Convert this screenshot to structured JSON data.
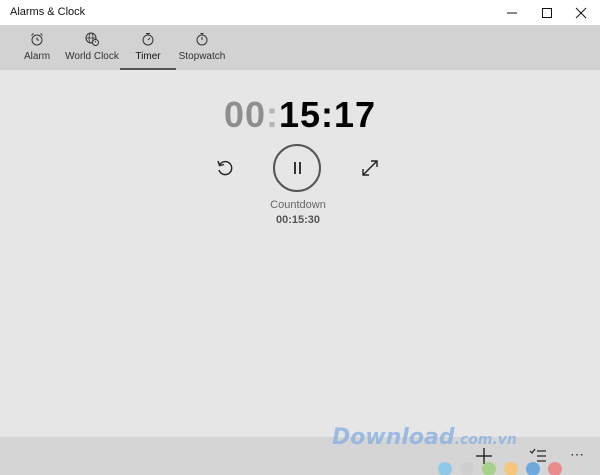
{
  "window": {
    "title": "Alarms & Clock",
    "controls": [
      "minimize-icon",
      "maximize-icon",
      "close-icon"
    ]
  },
  "tabs": [
    {
      "label": "Alarm",
      "icon": "alarm-clock-icon",
      "active": false
    },
    {
      "label": "World Clock",
      "icon": "globe-clock-icon",
      "active": false
    },
    {
      "label": "Timer",
      "icon": "timer-icon",
      "active": true
    },
    {
      "label": "Stopwatch",
      "icon": "stopwatch-icon",
      "active": false
    }
  ],
  "timer": {
    "hours": "00",
    "minutes_seconds": "15:17",
    "name": "Countdown",
    "duration": "00:15:30",
    "state": "running"
  },
  "controls": {
    "reset": "reset-icon",
    "pause": "pause-icon",
    "expand": "expand-icon"
  },
  "bottom_bar": {
    "add": "add-icon",
    "select": "select-list-icon",
    "more": "⋯"
  },
  "watermark": {
    "brand": "Download",
    "domain": ".com.vn",
    "dot_colors": [
      "#8ecae6",
      "#cfcfcf",
      "#a8d08d",
      "#f4c77d",
      "#6fa8dc",
      "#e88c8c"
    ]
  },
  "colors": {
    "background": "#e6e6e6",
    "tabbar": "#d2d2d2",
    "accent_dim": "#8e8e8e"
  }
}
